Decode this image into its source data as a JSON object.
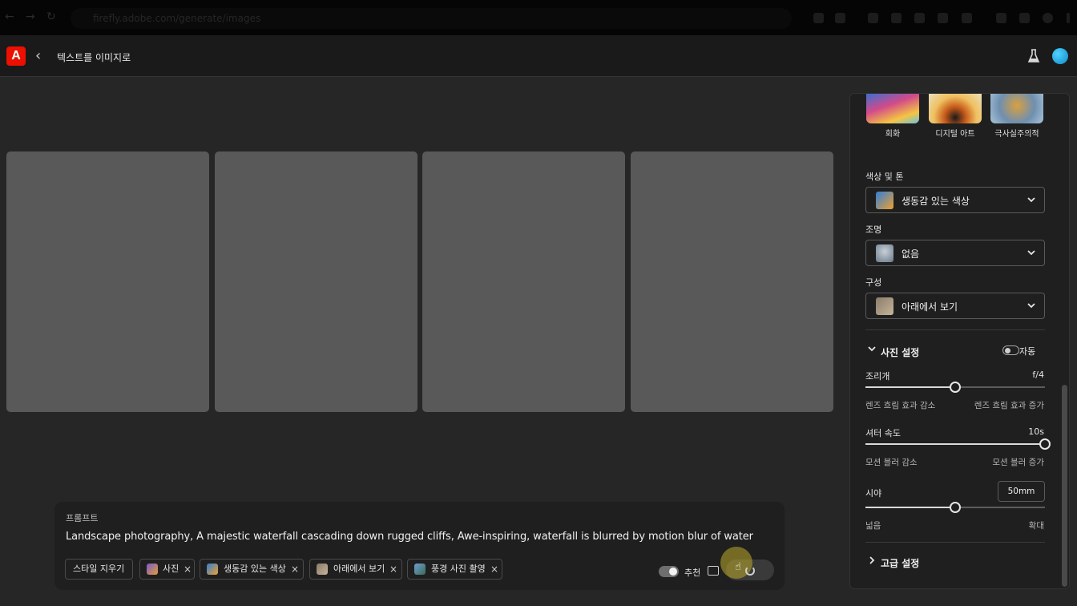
{
  "browser": {
    "url": "firefly.adobe.com/generate/images"
  },
  "header": {
    "title": "텍스트를 이미지로",
    "logo_letter": "A",
    "brand_color": "#eb1000"
  },
  "gallery": {
    "placeholder_count": 4
  },
  "prompt": {
    "label": "프롬프트",
    "text": "Landscape photography, A majestic waterfall cascading down rugged cliffs, Awe-inspiring, waterfall is blurred by motion blur of water",
    "clear_style_label": "스타일 지우기",
    "chips": [
      {
        "label": "사진",
        "remove": "×"
      },
      {
        "label": "생동감 있는 색상",
        "remove": "×"
      },
      {
        "label": "아래에서 보기",
        "remove": "×"
      },
      {
        "label": "풍경 사진 촬영",
        "remove": "×"
      }
    ],
    "recommend_label": "추천",
    "recommend_on": true
  },
  "panel": {
    "styles": [
      {
        "label": "회화"
      },
      {
        "label": "디지털 아트"
      },
      {
        "label": "극사실주의적"
      }
    ],
    "color_tone": {
      "label": "색상 및 톤",
      "value": "생동감 있는 색상"
    },
    "lighting": {
      "label": "조명",
      "value": "없음"
    },
    "composition": {
      "label": "구성",
      "value": "아래에서 보기"
    },
    "photo_settings": {
      "title": "사진 설정",
      "auto_label": "자동",
      "auto_on": false,
      "aperture": {
        "label": "조리개",
        "value": "f/4",
        "level": 0.5,
        "hint_left": "렌즈 흐림 효과 감소",
        "hint_right": "렌즈 흐림 효과 증가"
      },
      "shutter": {
        "label": "셔터 속도",
        "value": "10s",
        "level": 1.0,
        "hint_left": "모션 블러 감소",
        "hint_right": "모션 블러 증가"
      },
      "fov": {
        "label": "시야",
        "value": "50mm",
        "level": 0.5,
        "hint_left": "넓음",
        "hint_right": "확대"
      }
    },
    "advanced": {
      "title": "고급 설정"
    }
  }
}
